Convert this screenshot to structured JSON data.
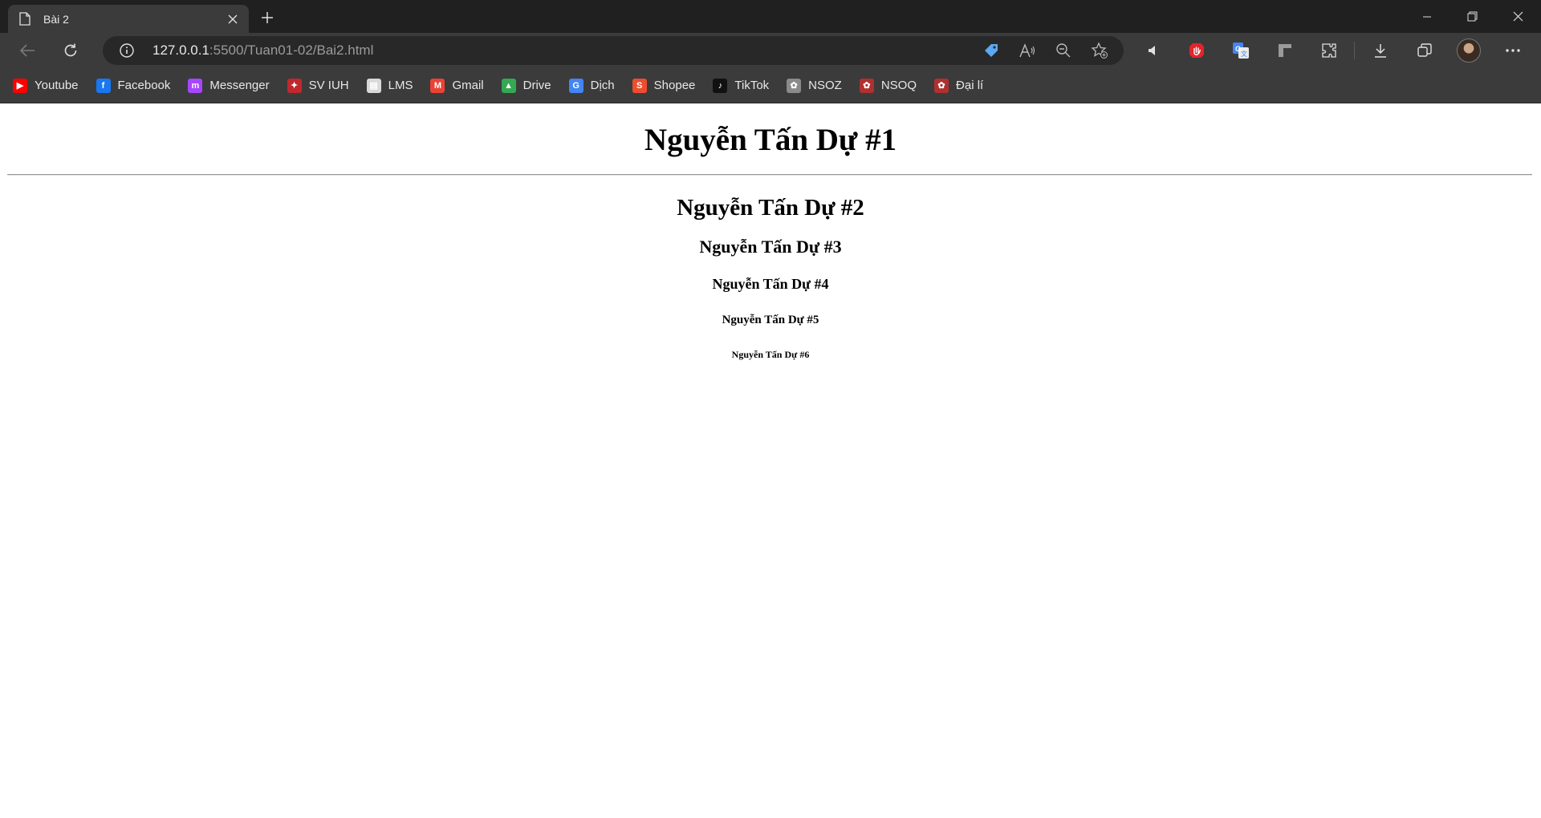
{
  "tab": {
    "title": "Bài 2"
  },
  "address": {
    "host": "127.0.0.1",
    "rest": ":5500/Tuan01-02/Bai2.html"
  },
  "bookmarks": [
    {
      "label": "Youtube",
      "icon": "youtube-icon",
      "color": "#ff0000",
      "glyph": "▶"
    },
    {
      "label": "Facebook",
      "icon": "facebook-icon",
      "color": "#1877f2",
      "glyph": "f"
    },
    {
      "label": "Messenger",
      "icon": "messenger-icon",
      "color": "#a745ff",
      "glyph": "m"
    },
    {
      "label": "SV IUH",
      "icon": "sv-iuh-icon",
      "color": "#c0282d",
      "glyph": "✦"
    },
    {
      "label": "LMS",
      "icon": "lms-icon",
      "color": "#d9d9d9",
      "glyph": "▤"
    },
    {
      "label": "Gmail",
      "icon": "gmail-icon",
      "color": "#ea4335",
      "glyph": "M"
    },
    {
      "label": "Drive",
      "icon": "drive-icon",
      "color": "#34a853",
      "glyph": "▲"
    },
    {
      "label": "Dịch",
      "icon": "translate-icon",
      "color": "#4285f4",
      "glyph": "G"
    },
    {
      "label": "Shopee",
      "icon": "shopee-icon",
      "color": "#ee4d2d",
      "glyph": "S"
    },
    {
      "label": "TikTok",
      "icon": "tiktok-icon",
      "color": "#111111",
      "glyph": "♪"
    },
    {
      "label": "NSOZ",
      "icon": "nsoz-icon",
      "color": "#8a8a8a",
      "glyph": "✿"
    },
    {
      "label": "NSOQ",
      "icon": "nsoq-icon",
      "color": "#b03030",
      "glyph": "✿"
    },
    {
      "label": "Đại lí",
      "icon": "dai-li-icon",
      "color": "#b03030",
      "glyph": "✿"
    }
  ],
  "content": {
    "h1": "Nguyễn Tấn Dự #1",
    "h2": "Nguyễn Tấn Dự #2",
    "h3": "Nguyễn Tấn Dự #3",
    "h4": "Nguyễn Tấn Dự #4",
    "h5": "Nguyễn Tấn Dự #5",
    "h6": "Nguyễn Tấn Dự #6"
  }
}
